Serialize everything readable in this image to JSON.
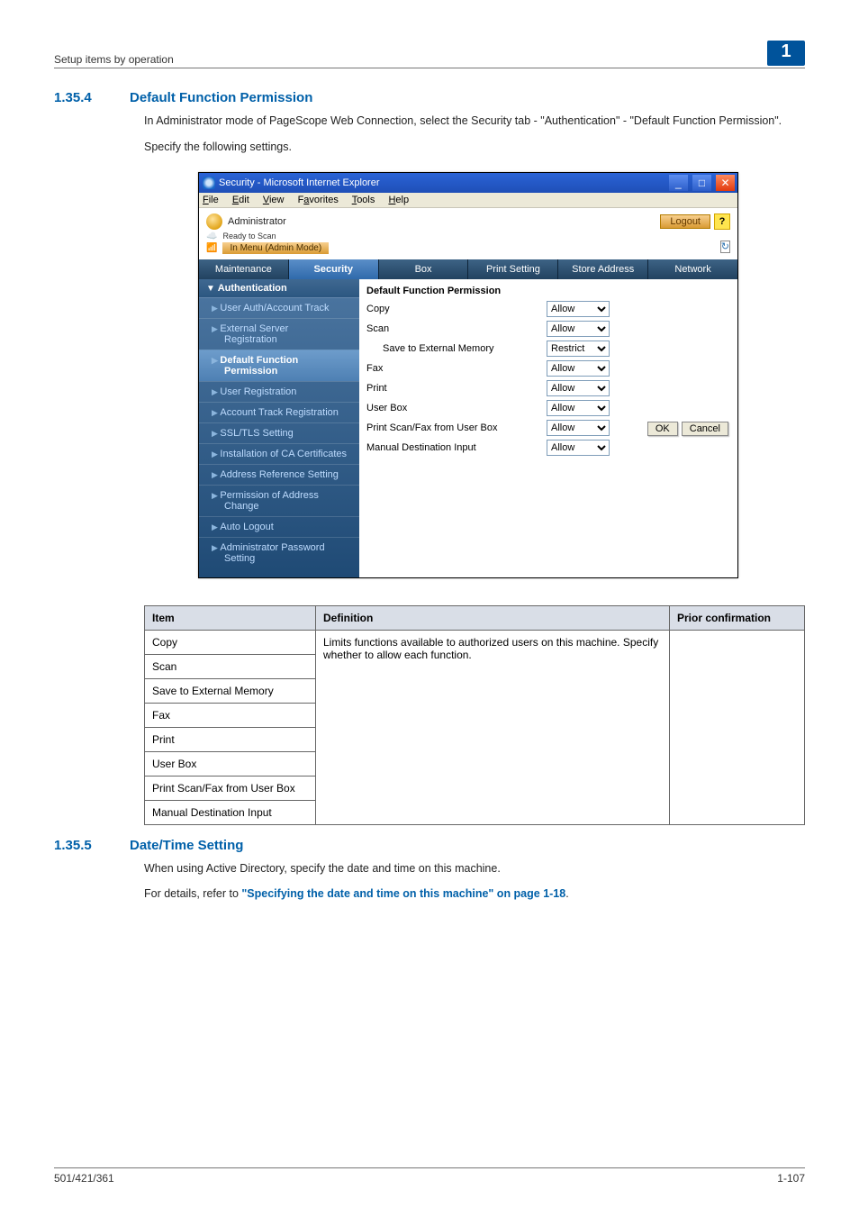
{
  "header": {
    "left_text": "Setup items by operation",
    "right_badge": "1"
  },
  "section1": {
    "num": "1.35.4",
    "title": "Default Function Permission",
    "para1": "In Administrator mode of PageScope Web Connection, select the Security tab - \"Authentication\" - \"Default Function Permission\".",
    "para2": "Specify the following settings."
  },
  "ie": {
    "title": "Security - Microsoft Internet Explorer",
    "menus": {
      "file": "File",
      "edit": "Edit",
      "view": "View",
      "favorites": "Favorites",
      "tools": "Tools",
      "help": "Help"
    },
    "admin_label": "Administrator",
    "ready": "Ready to Scan",
    "mode": "In Menu (Admin Mode)",
    "logout": "Logout",
    "help": "?",
    "refresh": "↻",
    "tabs": {
      "maintenance": "Maintenance",
      "security": "Security",
      "box": "Box",
      "print": "Print Setting",
      "store": "Store Address",
      "network": "Network"
    },
    "side": {
      "auth": "Authentication",
      "uat": "User Auth/Account Track",
      "ext1": "External Server",
      "ext2": "Registration",
      "dfp1": "Default Function",
      "dfp2": "Permission",
      "ureg": "User Registration",
      "atrack": "Account Track Registration",
      "ssl": "SSL/TLS Setting",
      "cacert": "Installation of CA Certificates",
      "ars": "Address Reference Setting",
      "poa1": "Permission of Address",
      "poa2": "Change",
      "alog": "Auto Logout",
      "apw1": "Administrator Password",
      "apw2": "Setting"
    },
    "pane": {
      "title": "Default Function Permission",
      "copy": "Copy",
      "scan": "Scan",
      "save_ext": "Save to External Memory",
      "fax": "Fax",
      "print": "Print",
      "userbox": "User Box",
      "psf": "Print Scan/Fax from User Box",
      "mdi": "Manual Destination Input",
      "allow": "Allow",
      "restrict": "Restrict",
      "ok": "OK",
      "cancel": "Cancel"
    }
  },
  "table": {
    "h_item": "Item",
    "h_def": "Definition",
    "h_prior": "Prior confirmation",
    "rows": {
      "copy": "Copy",
      "scan": "Scan",
      "save_ext": "Save to External Memory",
      "fax": "Fax",
      "print": "Print",
      "userbox": "User Box",
      "psf": "Print Scan/Fax from User Box",
      "mdi": "Manual Destination Input"
    },
    "def_text": "Limits functions available to authorized users on this machine. Specify whether to allow each function."
  },
  "section2": {
    "num": "1.35.5",
    "title": "Date/Time Setting",
    "para1": "When using Active Directory, specify the date and time on this machine.",
    "para2_pre": "For details, refer to ",
    "para2_link": "\"Specifying the date and time on this machine\" on page 1-18",
    "para2_post": "."
  },
  "footer": {
    "left": "501/421/361",
    "right": "1-107"
  }
}
